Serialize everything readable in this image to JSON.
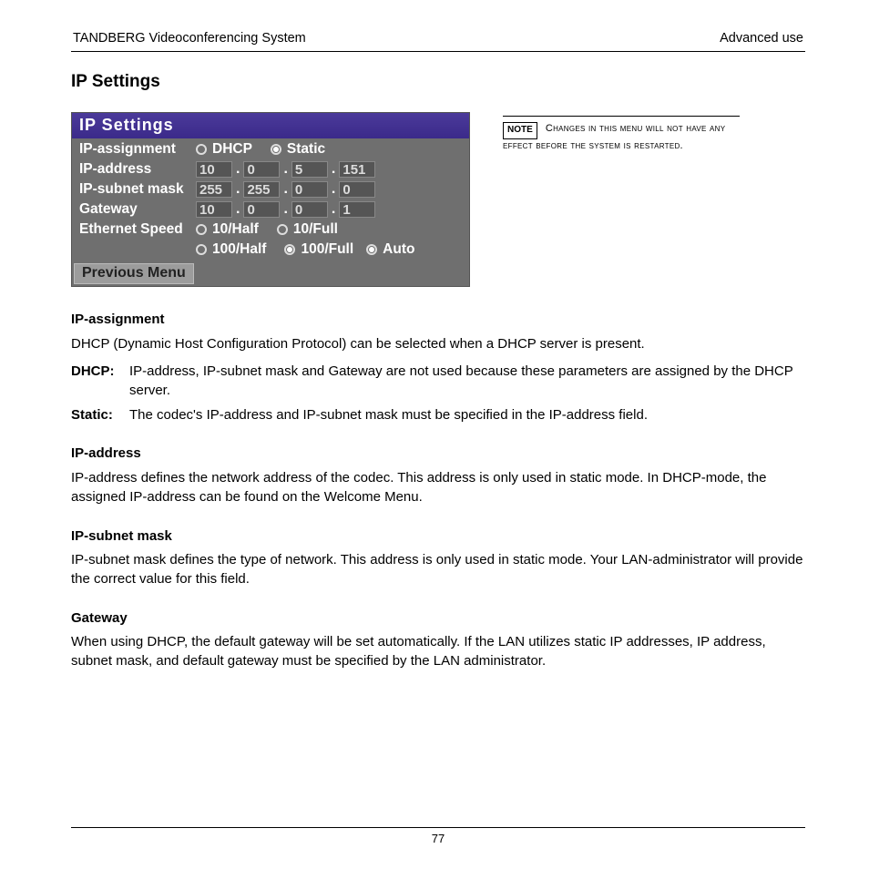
{
  "header": {
    "left": "TANDBERG Videoconferencing System",
    "right": "Advanced use"
  },
  "page_title": "IP Settings",
  "panel": {
    "title": "IP  Settings",
    "rows": {
      "assignment": {
        "label": "IP-assignment",
        "dhcp": "DHCP",
        "static_": "Static",
        "selected": "Static"
      },
      "address": {
        "label": "IP-address",
        "octets": [
          "10",
          "0",
          "5",
          "151"
        ]
      },
      "subnet": {
        "label": "IP-subnet mask",
        "octets": [
          "255",
          "255",
          "0",
          "0"
        ]
      },
      "gateway": {
        "label": "Gateway",
        "octets": [
          "10",
          "0",
          "0",
          "1"
        ]
      },
      "speed": {
        "label": "Ethernet Speed",
        "opts": [
          "10/Half",
          "10/Full",
          "100/Half",
          "100/Full",
          "Auto"
        ],
        "selected": "Auto"
      }
    },
    "previous": "Previous Menu"
  },
  "note": {
    "tag": "NOTE",
    "text": "Changes in this menu will not have any effect before the system is restarted."
  },
  "sections": {
    "assignment": {
      "heading": "IP-assignment",
      "intro": "DHCP (Dynamic Host Configuration Protocol) can be selected when a DHCP server is present.",
      "dhcp_term": "DHCP:",
      "dhcp_text": "IP-address, IP-subnet mask and Gateway are not used because these parameters are assigned by the DHCP server.",
      "static_term": "Static:",
      "static_text": "The codec's IP-address and IP-subnet mask must be specified in the IP-address field."
    },
    "address": {
      "heading": "IP-address",
      "text": "IP-address defines the network address of the codec. This address is only used in static mode. In DHCP-mode, the assigned IP-address can be found on the Welcome Menu."
    },
    "subnet": {
      "heading": "IP-subnet mask",
      "text": "IP-subnet mask defines the type of network. This address is only used in static mode. Your LAN-administrator will provide the correct value for this field."
    },
    "gateway": {
      "heading": "Gateway",
      "text": "When using DHCP, the default gateway will be set automatically. If the LAN utilizes static IP addresses, IP address, subnet mask, and default gateway must be specified by the LAN administrator."
    }
  },
  "page_number": "77"
}
